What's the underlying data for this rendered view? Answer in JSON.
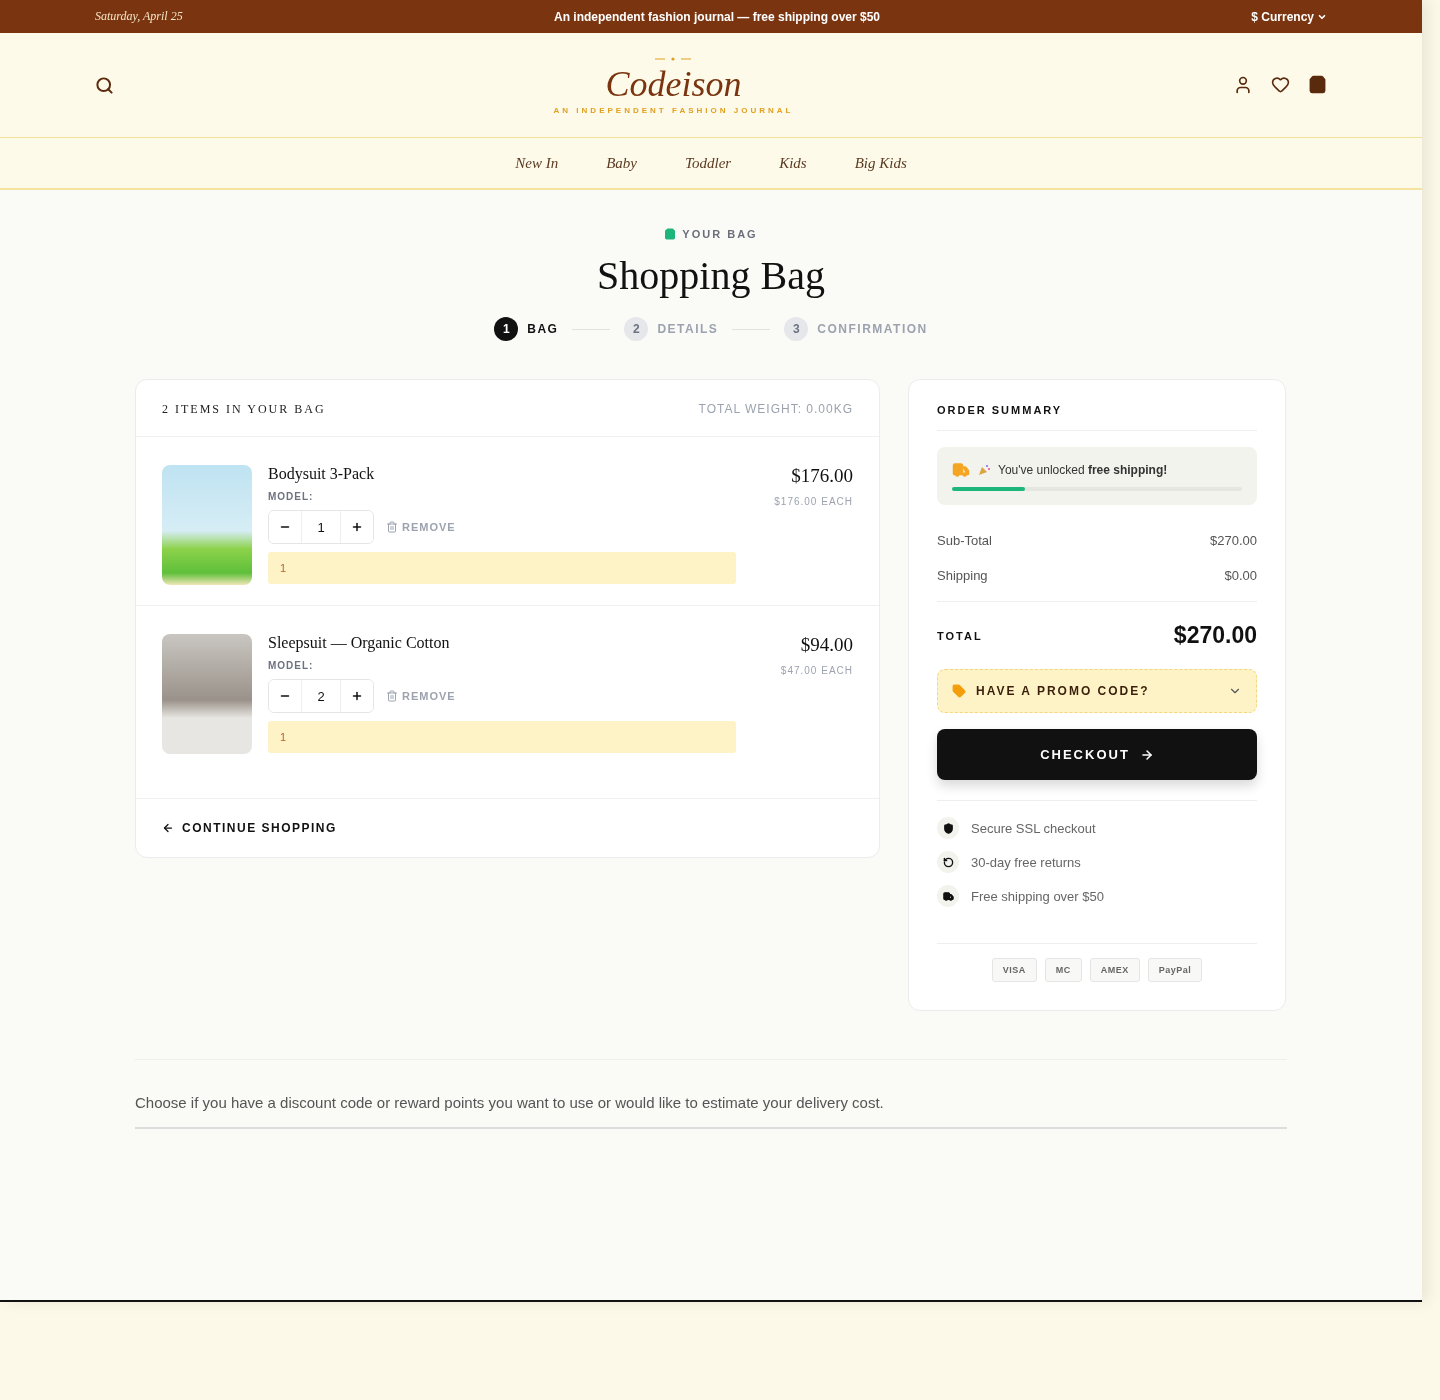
{
  "topbar": {
    "date": "Saturday, April 25",
    "message": "An independent fashion journal — free shipping over $50",
    "currency": "$ Currency"
  },
  "header": {
    "logo": "Codeison",
    "tagline": "AN INDEPENDENT FASHION JOURNAL"
  },
  "nav": [
    "New In",
    "Baby",
    "Toddler",
    "Kids",
    "Big Kids"
  ],
  "eyebrow": "YOUR BAG",
  "title": "Shopping Bag",
  "steps": [
    {
      "number": "1",
      "label": "BAG",
      "selected": true
    },
    {
      "number": "2",
      "label": "DETAILS",
      "selected": false
    },
    {
      "number": "3",
      "label": "CONFIRMATION",
      "selected": false
    }
  ],
  "cart": {
    "count_label": "2 ITEMS IN YOUR BAG",
    "weight": "TOTAL WEIGHT: 0.00KG",
    "items": [
      {
        "name": "Bodysuit 3-Pack",
        "model": "MODEL:",
        "quantity": "1",
        "remove": "REMOVE",
        "note": "1",
        "price": "$176.00",
        "each": "$176.00 EACH"
      },
      {
        "name": "Sleepsuit — Organic Cotton",
        "model": "MODEL:",
        "quantity": "2",
        "remove": "REMOVE",
        "note": "1",
        "price": "$94.00",
        "each": "$47.00 EACH"
      }
    ],
    "continue": "CONTINUE SHOPPING"
  },
  "summary": {
    "title": "ORDER SUMMARY",
    "shipping_message": "You've unlocked **free shipping!**",
    "shipping_progress": {
      "level": 0.25
    },
    "lines": [
      {
        "label": "Sub-Total",
        "value": "$270.00"
      },
      {
        "label": "Shipping",
        "value": "$0.00"
      }
    ],
    "total_label": "TOTAL",
    "total": "$270.00",
    "promo": "HAVE A PROMO CODE?",
    "checkout": "CHECKOUT",
    "assurances": [
      {
        "kind": "shield",
        "text": "Secure SSL checkout"
      },
      {
        "kind": "returns",
        "text": "30-day free returns"
      },
      {
        "kind": "truck",
        "text": "Free shipping over $50"
      }
    ],
    "payments": [
      "VISA",
      "MC",
      "AMEX",
      "PayPal"
    ]
  },
  "footer_note": "Choose if you have a discount code or reward points you want to use or would like to estimate your delivery cost."
}
